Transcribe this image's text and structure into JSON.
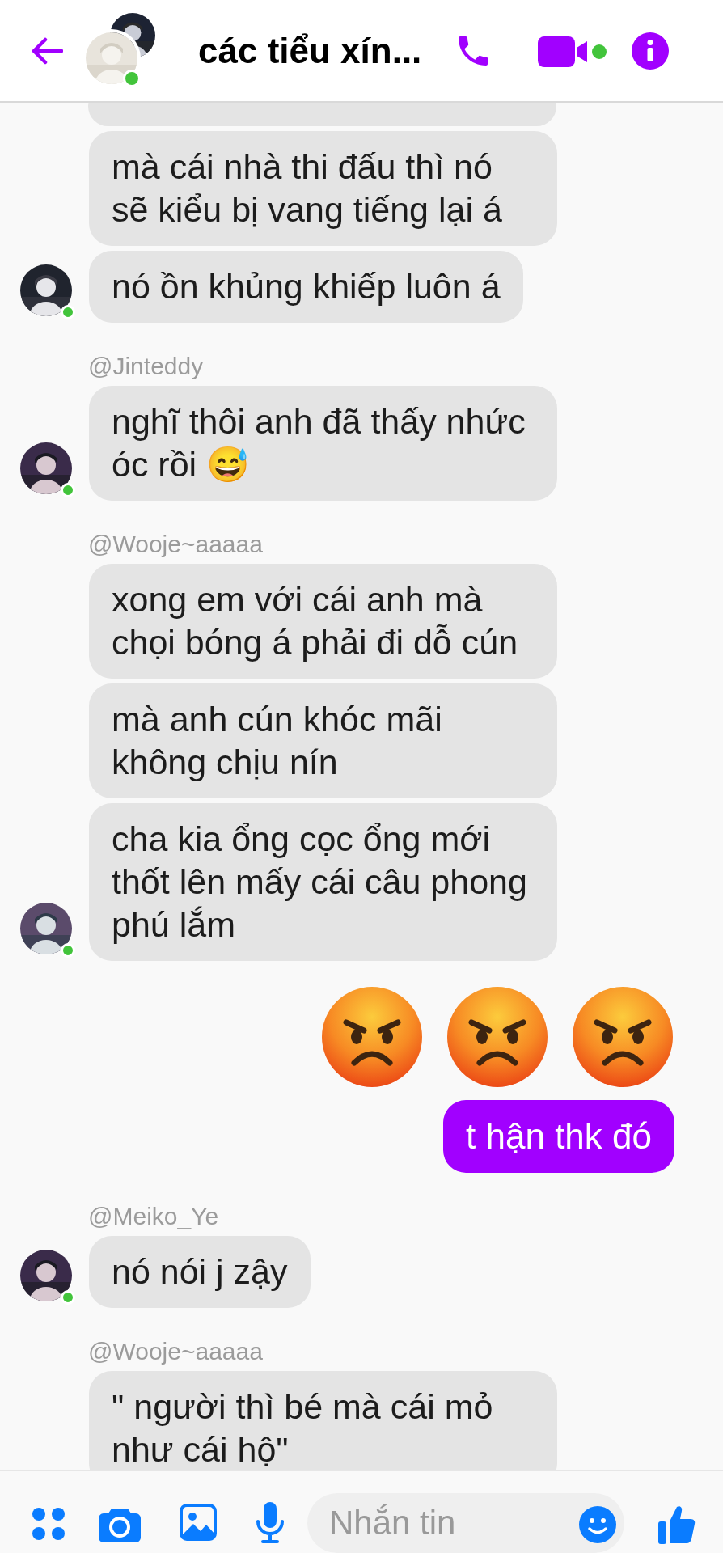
{
  "header": {
    "title": "các tiểu xín...",
    "online": true
  },
  "messages": [
    {
      "kind": "partial"
    },
    {
      "kind": "incoming",
      "text": "mà cái nhà thi đấu thì nó sẽ kiểu bị vang tiếng lại á",
      "avatar": false
    },
    {
      "kind": "incoming",
      "text": "nó ồn khủng khiếp luôn á",
      "avatar": true,
      "online": true
    },
    {
      "kind": "sender",
      "text": "@Jinteddy"
    },
    {
      "kind": "incoming",
      "text": "nghĩ thôi anh đã thấy nhức óc rồi 😅",
      "avatar": true,
      "online": true
    },
    {
      "kind": "sender",
      "text": "@Wooje~aaaaa"
    },
    {
      "kind": "incoming",
      "text": "xong em với cái anh mà chọi bóng á phải đi dỗ cún",
      "avatar": false
    },
    {
      "kind": "incoming",
      "text": "mà anh cún khóc mãi không chịu nín",
      "avatar": false
    },
    {
      "kind": "incoming",
      "text": "cha kia ổng cọc ổng mới thốt lên mấy cái câu phong phú lắm",
      "avatar": true,
      "online": true
    },
    {
      "kind": "emoji_row",
      "emojis": [
        {
          "kind": "angry"
        },
        {
          "kind": "angry"
        },
        {
          "kind": "angry"
        }
      ]
    },
    {
      "kind": "outgoing",
      "text": "t hận thk đó"
    },
    {
      "kind": "sender",
      "text": "@Meiko_Ye"
    },
    {
      "kind": "incoming",
      "text": "nó nói j zậy",
      "avatar": true,
      "online": true
    },
    {
      "kind": "sender",
      "text": "@Wooje~aaaaa"
    },
    {
      "kind": "incoming",
      "text": "\" người thì bé mà cái mỏ như cái hộ\"",
      "avatar": false
    }
  ],
  "composer": {
    "placeholder": "Nhắn tin"
  }
}
